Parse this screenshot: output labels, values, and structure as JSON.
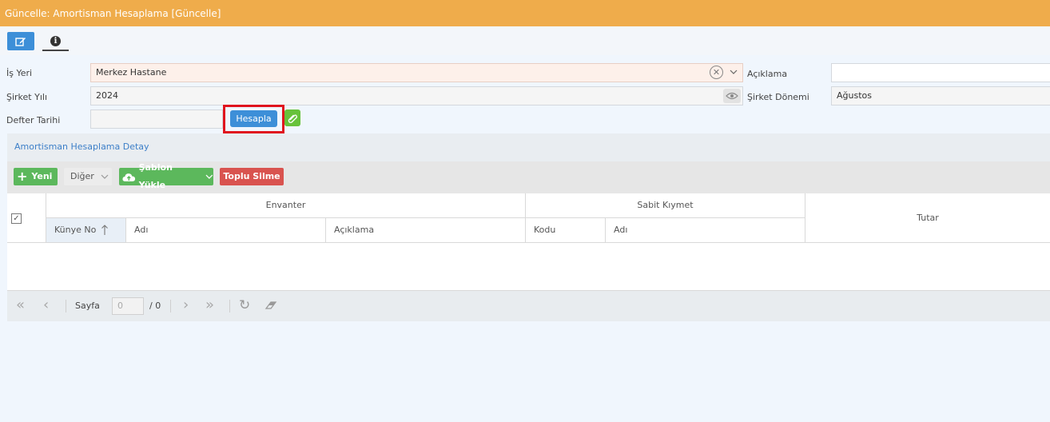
{
  "window": {
    "title": "Güncelle: Amortisman Hesaplama [Güncelle]"
  },
  "tabs": {
    "edit_icon": "edit-icon",
    "info_icon": "info-icon",
    "info_glyph": "i"
  },
  "form": {
    "is_yeri_label": "İş Yeri",
    "is_yeri_value": "Merkez Hastane",
    "sirket_yili_label": "Şirket Yılı",
    "sirket_yili_value": "2024",
    "defter_tarihi_label": "Defter Tarihi",
    "defter_tarihi_value": "",
    "aciklama_label": "Açıklama",
    "aciklama_value": "",
    "sirket_donemi_label": "Şirket Dönemi",
    "sirket_donemi_value": "Ağustos",
    "hesapla_label": "Hesapla"
  },
  "detail": {
    "title": "Amortisman Hesaplama Detay",
    "toolbar": {
      "yeni": "Yeni",
      "diger": "Diğer",
      "sablon_yukle": "Şablon Yükle",
      "toplu_silme": "Toplu Silme"
    },
    "grid": {
      "group_envanter": "Envanter",
      "group_sabit_kiymet": "Sabit Kıymet",
      "col_tutar": "Tutar",
      "col_kunye_no": "Künye No",
      "col_adi": "Adı",
      "col_aciklama": "Açıklama",
      "col_kodu": "Kodu",
      "col_adi2": "Adı",
      "rows": []
    },
    "pager": {
      "page_label": "Sayfa",
      "page_value": "0",
      "total": "/ 0"
    }
  },
  "colors": {
    "title_bar": "#efac4b",
    "primary": "#3d8fd8",
    "success": "#5cb85c",
    "danger": "#d9534f",
    "highlight_border": "#e0141e"
  }
}
